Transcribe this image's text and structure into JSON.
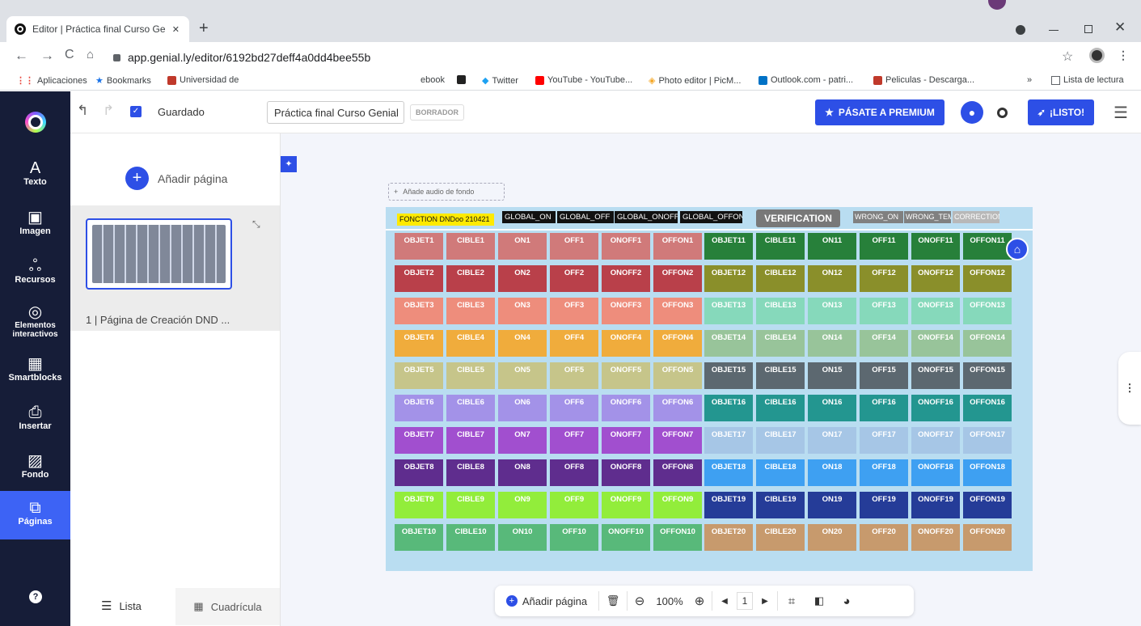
{
  "browser": {
    "tab_title": "Editor | Práctica final Curso Genia",
    "tab_close": "✕",
    "new_tab": "+",
    "url": "app.genial.ly/editor/6192bd27deff4a0dd4bee55b",
    "bookmarks": [
      "Aplicaciones",
      "Bookmarks",
      "Universidad de",
      "ebook",
      "Twitter",
      "YouTube - YouTube...",
      "Photo editor | PicM...",
      "Outlook.com - patri...",
      "Peliculas - Descarga..."
    ],
    "reading_list": "Lista de lectura",
    "more_bookmarks": "»"
  },
  "colors": {
    "sidebar_bg": "#161d38",
    "primary": "#2d4fe6",
    "accent_active": "#3d63f5"
  },
  "sidebar": {
    "items": [
      {
        "label": "Texto",
        "icon": "text-icon",
        "glyph": "A"
      },
      {
        "label": "Imagen",
        "icon": "image-icon",
        "glyph": "▣"
      },
      {
        "label": "Recursos",
        "icon": "resources-icon",
        "glyph": "ஃ"
      },
      {
        "label": "Elementos interactivos",
        "icon": "interactive-icon",
        "glyph": "◎"
      },
      {
        "label": "Smartblocks",
        "icon": "smartblocks-icon",
        "glyph": "▦"
      },
      {
        "label": "Insertar",
        "icon": "insert-icon",
        "glyph": "⎙"
      },
      {
        "label": "Fondo",
        "icon": "background-icon",
        "glyph": "▨"
      },
      {
        "label": "Páginas",
        "icon": "pages-icon",
        "glyph": "⧉"
      }
    ],
    "help": "?"
  },
  "topbar": {
    "saved": "Guardado",
    "title_value": "Práctica final Curso Genial",
    "draft": "BORRADOR",
    "premium": "PÁSATE A PREMIUM",
    "ready": "¡LISTO!"
  },
  "pages": {
    "add_page": "Añadir página",
    "page_label": "1 | Página de Creación DND ...",
    "view_list": "Lista",
    "view_grid": "Cuadrícula"
  },
  "canvas": {
    "audio": "Añade audio de fondo",
    "header": {
      "fonction": "FONCTION DNDoo 210421",
      "global_on": "GLOBAL_ON",
      "global_off": "GLOBAL_OFF",
      "global_onoff": "GLOBAL_ONOFF",
      "global_offon": "GLOBAL_OFFON",
      "verification": "VERIFICATION",
      "wrong_on": "WRONG_ON",
      "wrong_tem": "WRONG_TEM",
      "correction": "CORRECTION"
    },
    "left_rows": [
      {
        "color": "#d07a7a",
        "cells": [
          "OBJET1",
          "CIBLE1",
          "ON1",
          "OFF1",
          "ONOFF1",
          "OFFON1"
        ]
      },
      {
        "color": "#b9404a",
        "cells": [
          "OBJET2",
          "CIBLE2",
          "ON2",
          "OFF2",
          "ONOFF2",
          "OFFON2"
        ]
      },
      {
        "color": "#ee8d7c",
        "cells": [
          "OBJET3",
          "CIBLE3",
          "ON3",
          "OFF3",
          "ONOFF3",
          "OFFON3"
        ]
      },
      {
        "color": "#f0ac3c",
        "cells": [
          "OBJET4",
          "CIBLE4",
          "ON4",
          "OFF4",
          "ONOFF4",
          "OFFON4"
        ]
      },
      {
        "color": "#c6c58a",
        "cells": [
          "OBJET5",
          "CIBLE5",
          "ON5",
          "OFF5",
          "ONOFF5",
          "OFFON5"
        ]
      },
      {
        "color": "#a392e8",
        "cells": [
          "OBJET6",
          "CIBLE6",
          "ON6",
          "OFF6",
          "ONOFF6",
          "OFFON6"
        ]
      },
      {
        "color": "#a14fcf",
        "cells": [
          "OBJET7",
          "CIBLE7",
          "ON7",
          "OFF7",
          "ONOFF7",
          "OFFON7"
        ]
      },
      {
        "color": "#5f2d8e",
        "cells": [
          "OBJET8",
          "CIBLE8",
          "ON8",
          "OFF8",
          "ONOFF8",
          "OFFON8"
        ]
      },
      {
        "color": "#92ed3b",
        "cells": [
          "OBJET9",
          "CIBLE9",
          "ON9",
          "OFF9",
          "ONOFF9",
          "OFFON9"
        ]
      },
      {
        "color": "#58b97a",
        "cells": [
          "OBJET10",
          "CIBLE10",
          "ON10",
          "OFF10",
          "ONOFF10",
          "OFFON10"
        ]
      }
    ],
    "right_rows": [
      {
        "color": "#27803a",
        "cells": [
          "OBJET11",
          "CIBLE11",
          "ON11",
          "OFF11",
          "ONOFF11",
          "OFFON11"
        ]
      },
      {
        "color": "#8a8f2a",
        "cells": [
          "OBJET12",
          "CIBLE12",
          "ON12",
          "OFF12",
          "ONOFF12",
          "OFFON12"
        ]
      },
      {
        "color": "#86d9bb",
        "cells": [
          "OBJET13",
          "CIBLE13",
          "ON13",
          "OFF13",
          "ONOFF13",
          "OFFON13"
        ]
      },
      {
        "color": "#98c49a",
        "cells": [
          "OBJET14",
          "CIBLE14",
          "ON14",
          "OFF14",
          "ONOFF14",
          "OFFON14"
        ]
      },
      {
        "color": "#5c6870",
        "cells": [
          "OBJET15",
          "CIBLE15",
          "ON15",
          "OFF15",
          "ONOFF15",
          "OFFON15"
        ]
      },
      {
        "color": "#239690",
        "cells": [
          "OBJET16",
          "CIBLE16",
          "ON16",
          "OFF16",
          "ONOFF16",
          "OFFON16"
        ]
      },
      {
        "color": "#a6c6e6",
        "cells": [
          "OBJET17",
          "CIBLE17",
          "ON17",
          "OFF17",
          "ONOFF17",
          "OFFON17"
        ]
      },
      {
        "color": "#3ea0f2",
        "cells": [
          "OBJET18",
          "CIBLE18",
          "ON18",
          "OFF18",
          "ONOFF18",
          "OFFON18"
        ]
      },
      {
        "color": "#253c98",
        "cells": [
          "OBJET19",
          "CIBLE19",
          "ON19",
          "OFF19",
          "ONOFF19",
          "OFFON19"
        ]
      },
      {
        "color": "#c79a6d",
        "cells": [
          "OBJET20",
          "CIBLE20",
          "ON20",
          "OFF20",
          "ONOFF20",
          "OFFON20"
        ]
      }
    ]
  },
  "bottombar": {
    "add_page": "Añadir página",
    "zoom": "100%",
    "page_num": "1"
  }
}
